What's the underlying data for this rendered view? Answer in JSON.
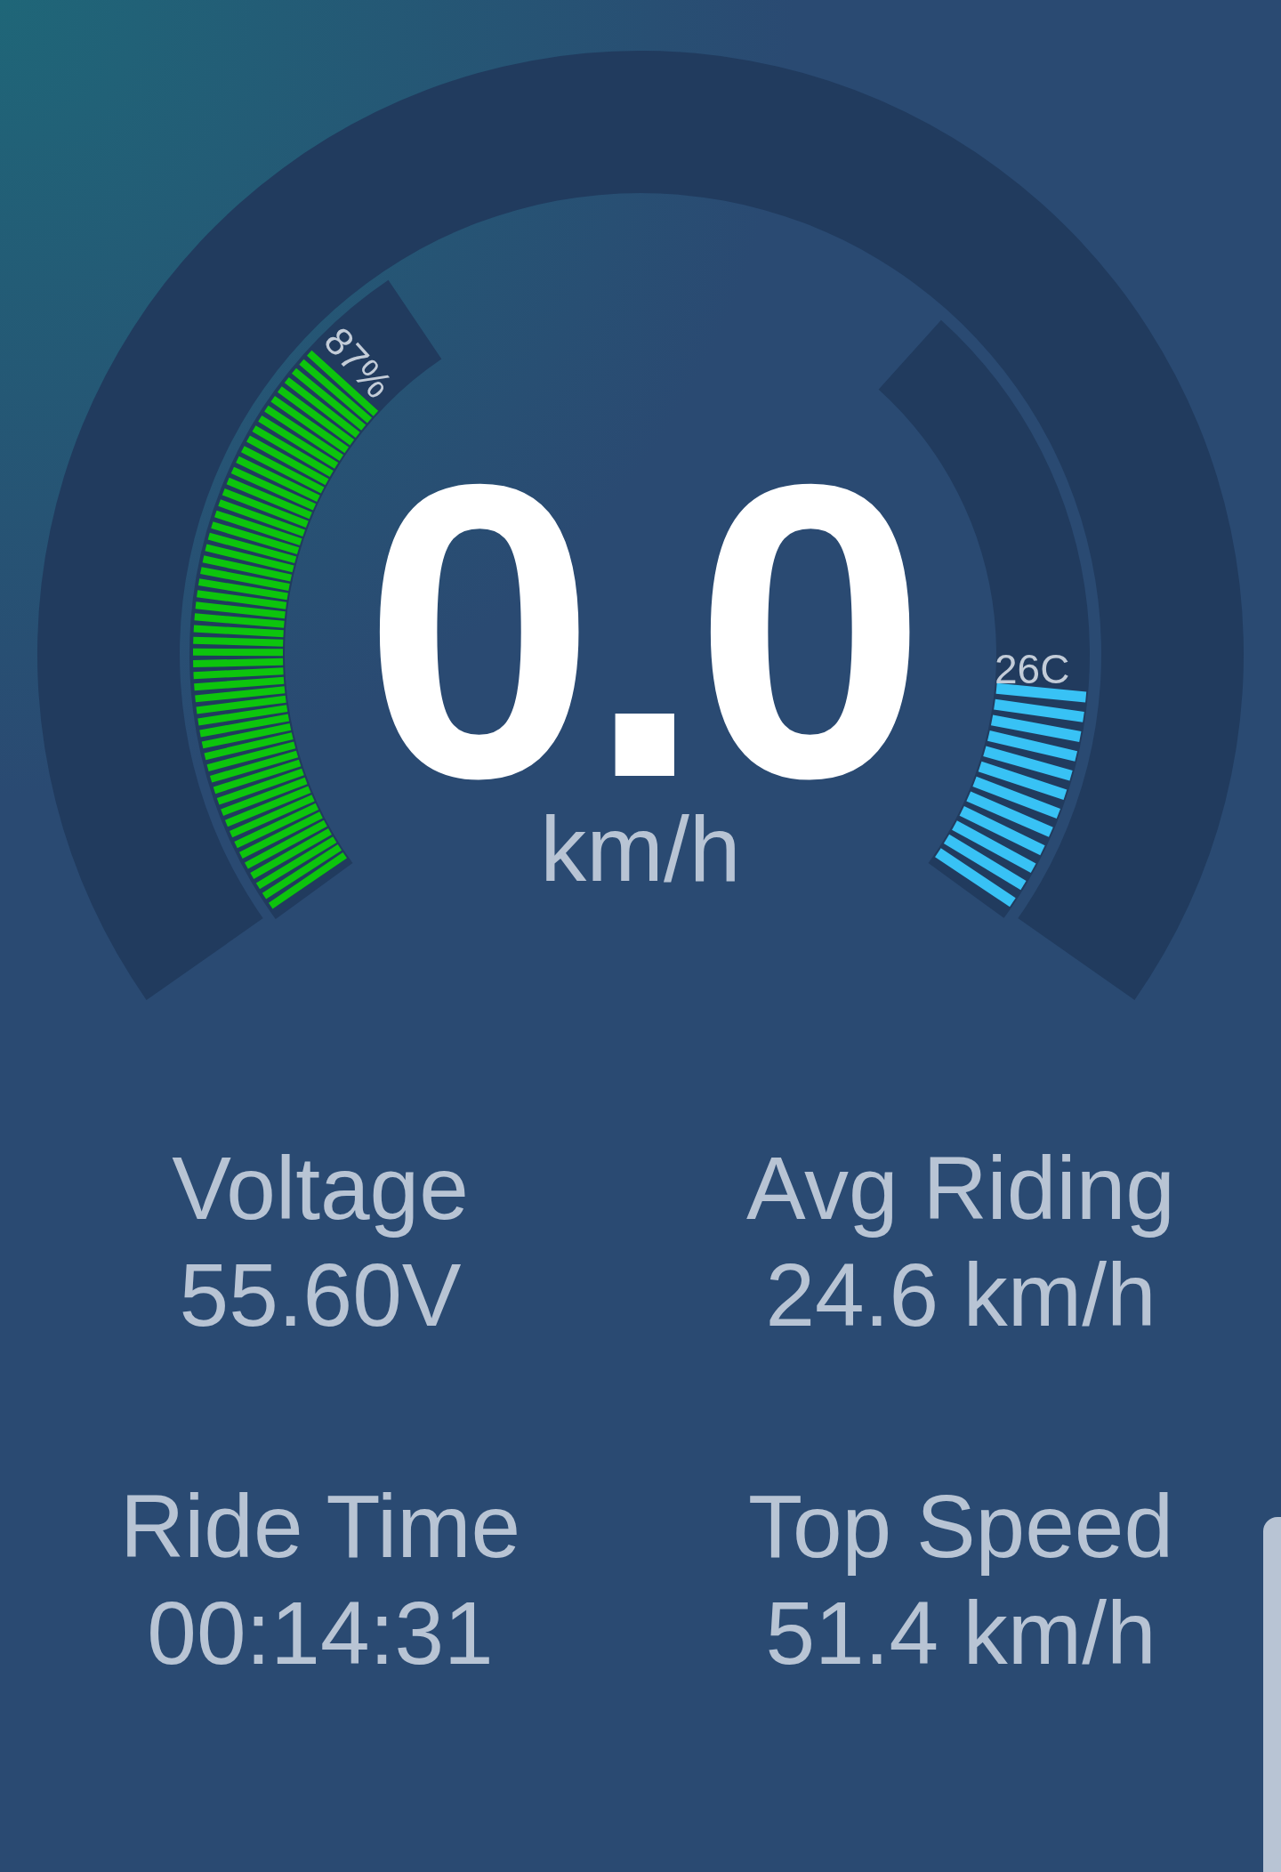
{
  "battery": {
    "reading": "87%"
  },
  "temperature": {
    "reading": "26C"
  },
  "speed": {
    "value": "0.0",
    "unit": "km/h"
  },
  "stats": [
    {
      "label": "Voltage",
      "value": "55.60V"
    },
    {
      "label": "Avg Riding",
      "value": "24.6 km/h"
    },
    {
      "label": "Ride Time",
      "value": "00:14:31"
    },
    {
      "label": "Top Speed",
      "value": "51.4 km/h"
    }
  ]
}
